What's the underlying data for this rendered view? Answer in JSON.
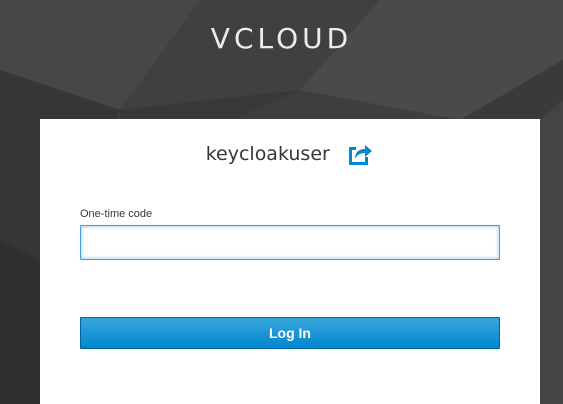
{
  "realm": {
    "title": "VCLOUD"
  },
  "login": {
    "username": "keycloakuser",
    "reset_icon": "external-link-icon",
    "otp_label": "One-time code",
    "otp_value": "",
    "submit_label": "Log In"
  },
  "colors": {
    "accent": "#0088ce",
    "background": "#3d3d3d",
    "card": "#ffffff"
  }
}
